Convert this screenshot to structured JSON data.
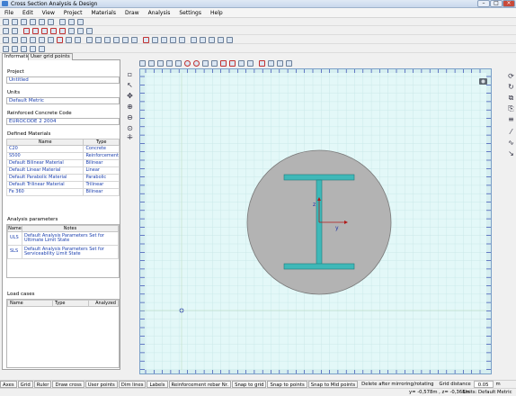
{
  "window": {
    "title": "Cross Section Analysis & Design"
  },
  "menu": [
    "File",
    "Edit",
    "View",
    "Project",
    "Materials",
    "Draw",
    "Analysis",
    "Settings",
    "Help"
  ],
  "tabs": [
    "Information",
    "User grid points"
  ],
  "project": {
    "label": "Project",
    "value": "Untitled"
  },
  "units": {
    "label": "Units",
    "value": "Default Metric"
  },
  "code": {
    "label": "Reinforced Concrete Code",
    "value": "EUROCODE 2 2004"
  },
  "materials": {
    "label": "Defined Materials",
    "headers": [
      "Name",
      "Type"
    ],
    "rows": [
      [
        "C20",
        "Concrete"
      ],
      [
        "S500",
        "Reinforcement"
      ],
      [
        "Default Bilinear Material",
        "Bilinear"
      ],
      [
        "Default Linear Material",
        "Linear"
      ],
      [
        "Default Parabolic Material",
        "Parabolic"
      ],
      [
        "Default Trilinear Material",
        "Trilinear"
      ],
      [
        "Fe 360",
        "Bilinear"
      ]
    ]
  },
  "analysis": {
    "label": "Analysis parameters",
    "headers": [
      "Name",
      "Notes"
    ],
    "rows": [
      [
        "ULS",
        "Default Analysis Parameters Set for Ultimate Limit State"
      ],
      [
        "SLS",
        "Default Analysis Parameters Set for Serviceability Limit State"
      ]
    ]
  },
  "loadcases": {
    "label": "Load cases",
    "headers": [
      "Name",
      "Type",
      "Analyzed"
    ]
  },
  "axis_labels": {
    "x": "y",
    "y": "z"
  },
  "bottom_buttons": [
    "Axes",
    "Grid",
    "Ruler",
    "Draw cross",
    "User points",
    "Dim lines",
    "Labels",
    "Reinforcement rebar Nr.",
    "Snap to grid",
    "Snap to points",
    "Snap to Mid points"
  ],
  "bottom_text": {
    "delete": "Delete after mirroring/rotating",
    "grid_label": "Grid distance",
    "grid_value": "0.05",
    "grid_unit": "m"
  },
  "status": {
    "coords": "y= -0,578m , z= -0,368m",
    "units": "Units: Default Metric"
  },
  "colors": {
    "canvas": "#e3f8f8",
    "steel": "#3fb8b8",
    "concrete": "#b3b3b3",
    "link": "#1b3fae"
  }
}
